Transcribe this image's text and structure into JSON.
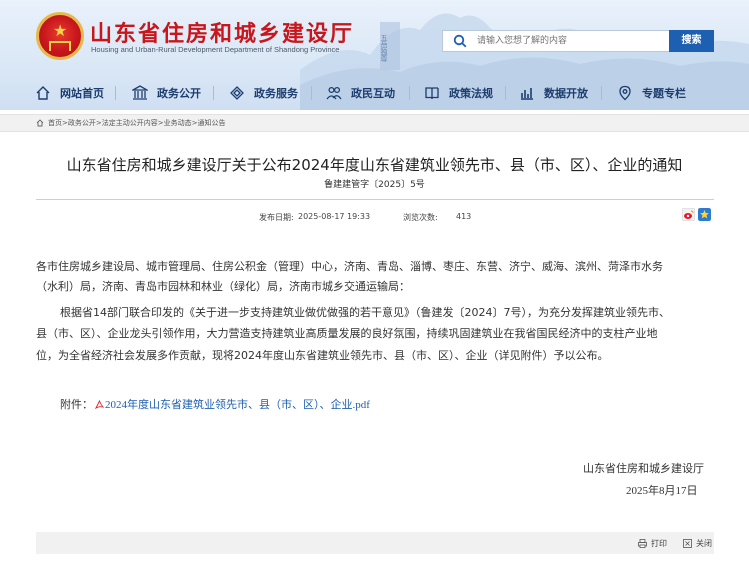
{
  "header": {
    "title": "山东省住房和城乡建设厅",
    "subtitle": "Housing and Urban-Rural Development Department of Shandong Province",
    "search_placeholder": "请输入您想了解的内容",
    "search_button": "搜索",
    "mountain_text": "五岳独尊"
  },
  "nav": {
    "items": [
      {
        "label": "网站首页",
        "icon": "home-icon"
      },
      {
        "label": "政务公开",
        "icon": "building-icon"
      },
      {
        "label": "政务服务",
        "icon": "service-icon"
      },
      {
        "label": "政民互动",
        "icon": "people-icon"
      },
      {
        "label": "政策法规",
        "icon": "book-icon"
      },
      {
        "label": "数据开放",
        "icon": "chart-icon"
      },
      {
        "label": "专题专栏",
        "icon": "pin-icon"
      }
    ]
  },
  "breadcrumb": "首页>政务公开>法定主动公开内容>业务动态>通知公告",
  "article": {
    "title": "山东省住房和城乡建设厅关于公布2024年度山东省建筑业领先市、县（市、区）、企业的通知",
    "doc_number": "鲁建建管字〔2025〕5号",
    "publish_label": "发布日期:",
    "publish_date": "2025-08-17 19:33",
    "views_label": "浏览次数:",
    "views": "413",
    "recipients_line1": "各市住房城乡建设局、城市管理局、住房公积金（管理）中心，济南、青岛、淄博、枣庄、东营、济宁、威海、滨州、菏泽市水务",
    "recipients_line2": "（水利）局，济南、青岛市园林和林业（绿化）局，济南市城乡交通运输局：",
    "body_line1": "根据省14部门联合印发的《关于进一步支持建筑业做优做强的若干意见》（鲁建发〔2024〕7号），为充分发挥建筑业领先市、",
    "body_line2": "县（市、区）、企业龙头引领作用，大力营造支持建筑业高质量发展的良好氛围，持续巩固建筑业在我省国民经济中的支柱产业地",
    "body_line3": "位，为全省经济社会发展多作贡献，现将2024年度山东省建筑业领先市、县（市、区）、企业（详见附件）予以公布。",
    "attachment_label": "附件：",
    "attachment_link": "2024年度山东省建筑业领先市、县（市、区）、企业.pdf",
    "signer": "山东省住房和城乡建设厅",
    "sign_date": "2025年8月17日"
  },
  "footer": {
    "print": "打印",
    "close": "关闭"
  },
  "colors": {
    "brand_red": "#c8161d",
    "brand_blue": "#1d5fb0",
    "nav_text": "#1d3d6e"
  }
}
